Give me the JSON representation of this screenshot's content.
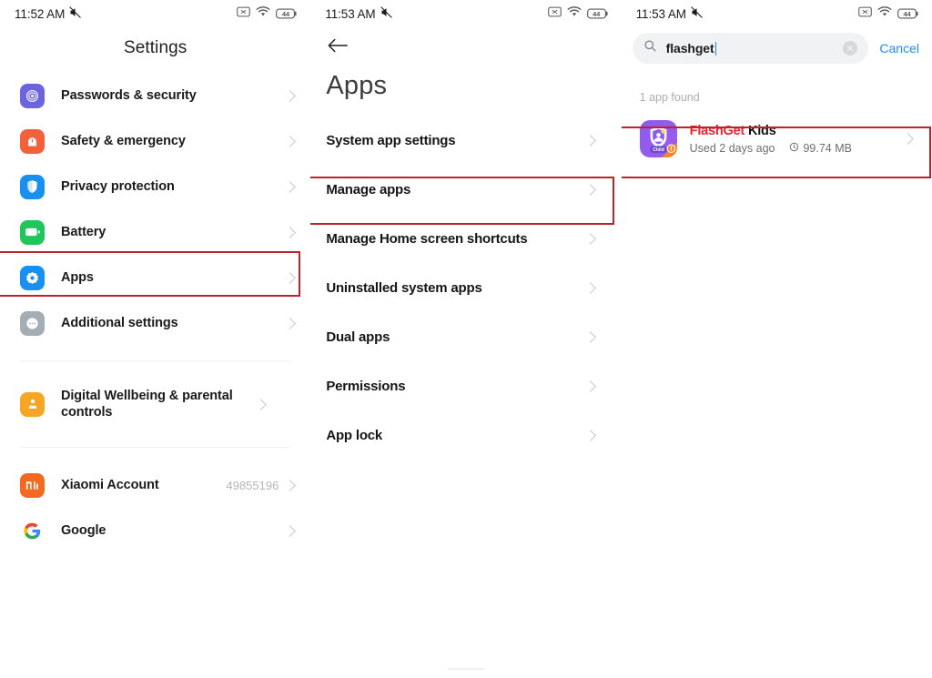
{
  "meta": {
    "colors": {
      "accent_red": "#c0212a",
      "brand_red": "#f0222e",
      "link_blue": "#1a8cff",
      "caret_blue": "#2a7fff",
      "text_primary": "#1a1a1a",
      "text_muted": "#aeaeae"
    }
  },
  "panel_settings": {
    "statusbar": {
      "time": "11:52 AM",
      "icons": [
        "mute-icon",
        "sim-x-icon",
        "wifi-icon",
        "battery-icon"
      ],
      "battery_level": "44"
    },
    "title": "Settings",
    "items": [
      {
        "label": "Passwords & security",
        "icon": "fingerprint-icon",
        "icon_color": "#6b63e0",
        "value": "",
        "highlighted": false
      },
      {
        "label": "Safety & emergency",
        "icon": "siren-icon",
        "icon_color": "#f2603c",
        "value": "",
        "highlighted": false
      },
      {
        "label": "Privacy protection",
        "icon": "privacy-shield-icon",
        "icon_color": "#1790f0",
        "value": "",
        "highlighted": false
      },
      {
        "label": "Battery",
        "icon": "battery-settings-icon",
        "icon_color": "#20c659",
        "value": "",
        "highlighted": false
      },
      {
        "label": "Apps",
        "icon": "apps-gear-icon",
        "icon_color": "#1790f0",
        "value": "",
        "highlighted": true
      },
      {
        "label": "Additional settings",
        "icon": "dots-bubble-icon",
        "icon_color": "#a5adb5",
        "value": "",
        "highlighted": false
      }
    ],
    "group2": [
      {
        "label": "Digital Wellbeing & parental controls",
        "icon": "person-download-icon",
        "icon_color": "#f5a623",
        "value": ""
      }
    ],
    "group3": [
      {
        "label": "Xiaomi Account",
        "icon": "mi-logo-icon",
        "icon_color": "#f26a21",
        "value": "49855196"
      },
      {
        "label": "Google",
        "icon": "google-g-icon",
        "icon_color": "#ffffff",
        "value": ""
      }
    ]
  },
  "panel_apps": {
    "statusbar": {
      "time": "11:53 AM",
      "battery_level": "44"
    },
    "back_label": "back-arrow",
    "title": "Apps",
    "items": [
      {
        "label": "System app settings",
        "highlighted": false
      },
      {
        "label": "Manage apps",
        "highlighted": true
      },
      {
        "label": "Manage Home screen shortcuts",
        "highlighted": false
      },
      {
        "label": "Uninstalled system apps",
        "highlighted": false
      },
      {
        "label": "Dual apps",
        "highlighted": false
      },
      {
        "label": "Permissions",
        "highlighted": false
      },
      {
        "label": "App lock",
        "highlighted": false
      }
    ]
  },
  "panel_search": {
    "statusbar": {
      "time": "11:53 AM",
      "battery_level": "44"
    },
    "search": {
      "value": "flashget",
      "placeholder": "Search",
      "clear_label": "×",
      "cancel_label": "Cancel"
    },
    "result_count_text": "1 app found",
    "results": [
      {
        "name_brand": "FlashGet",
        "name_rest": " Kids",
        "used": "Used 2 days ago",
        "size": "99.74 MB",
        "icon_badge": "Child",
        "highlighted": true
      }
    ]
  }
}
